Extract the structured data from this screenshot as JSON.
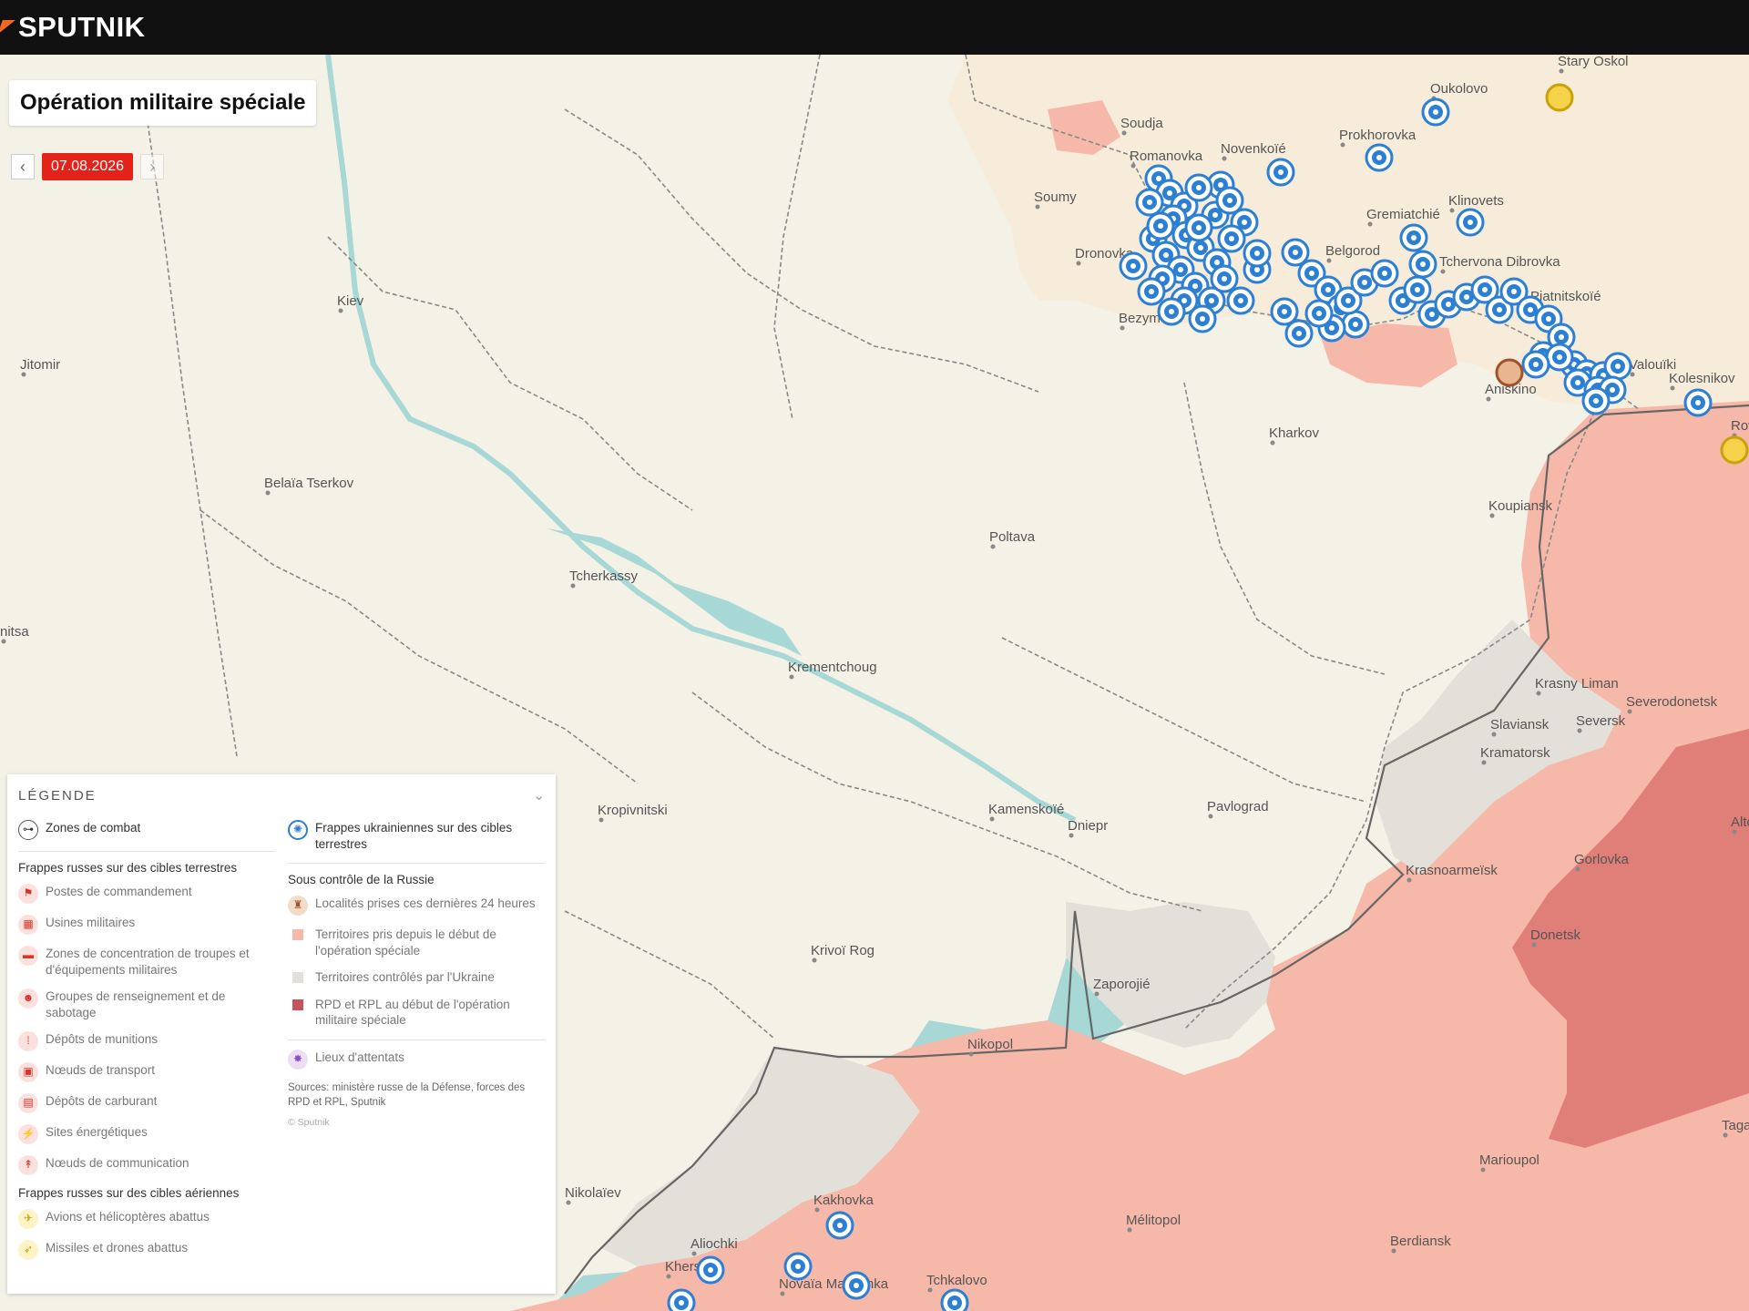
{
  "header": {
    "logo": "SPUTNIK"
  },
  "map": {
    "title": "Opération militaire spéciale",
    "date": "07.08.2026",
    "colors": {
      "land": "#f4f1e7",
      "russian_taken": "#f6b8a8",
      "rpd_rpl": "#e07e78",
      "ukraine_controlled": "#e3e0da",
      "water": "#a8d8d6",
      "strike": "#2d7fd3"
    },
    "cities": [
      {
        "name": "Soudja"
      },
      {
        "name": "Soumy"
      },
      {
        "name": "Romanovka"
      },
      {
        "name": "Novenkoïé"
      },
      {
        "name": "Prokhorovka"
      },
      {
        "name": "Oukolovo"
      },
      {
        "name": "Stary Oskol"
      },
      {
        "name": "Gremiatchié"
      },
      {
        "name": "Klinovets"
      },
      {
        "name": "Belgorod"
      },
      {
        "name": "Tchervona Dibrovka"
      },
      {
        "name": "Dronovka"
      },
      {
        "name": "Bezymeno"
      },
      {
        "name": "Piatnitskoïé"
      },
      {
        "name": "Valouïki"
      },
      {
        "name": "Kolesnikov"
      },
      {
        "name": "Aniskino"
      },
      {
        "name": "Rover"
      },
      {
        "name": "Kharkov"
      },
      {
        "name": "Koupiansk"
      },
      {
        "name": "Kiev"
      },
      {
        "name": "Jitomir"
      },
      {
        "name": "Belaïa Tserkov"
      },
      {
        "name": "nitsa"
      },
      {
        "name": "Poltava"
      },
      {
        "name": "Tcherkassy"
      },
      {
        "name": "Krementchoug"
      },
      {
        "name": "Krasny Liman"
      },
      {
        "name": "Severodonetsk"
      },
      {
        "name": "Slaviansk"
      },
      {
        "name": "Seversk"
      },
      {
        "name": "Kramatorsk"
      },
      {
        "name": "Kropivnitski"
      },
      {
        "name": "Kamenskoïé"
      },
      {
        "name": "Dniepr"
      },
      {
        "name": "Pavlograd"
      },
      {
        "name": "Altchevsk"
      },
      {
        "name": "Krasnoarmeïsk"
      },
      {
        "name": "Gorlovka"
      },
      {
        "name": "Donetsk"
      },
      {
        "name": "Krivoï Rog"
      },
      {
        "name": "Zaporojié"
      },
      {
        "name": "Nikopol"
      },
      {
        "name": "Taganrog"
      },
      {
        "name": "Marioupol"
      },
      {
        "name": "Nikolaïev"
      },
      {
        "name": "Kakhovka"
      },
      {
        "name": "Aliochki"
      },
      {
        "name": "Kherson"
      },
      {
        "name": "Mélitopol"
      },
      {
        "name": "Berdiansk"
      },
      {
        "name": "Novaïa Maiatchka"
      },
      {
        "name": "Tchkalovo"
      }
    ]
  },
  "legend": {
    "title": "LÉGENDE",
    "combat": "Zones de combat",
    "ground_header": "Frappes russes sur des cibles terrestres",
    "ground_items": [
      "Postes de commandement",
      "Usines militaires",
      "Zones de concentration de troupes et d'équipements militaires",
      "Groupes de renseignement et de sabotage",
      "Dépôts de munitions",
      "Nœuds de transport",
      "Dépôts de carburant",
      "Sites énergétiques",
      "Nœuds de communication"
    ],
    "air_header": "Frappes russes sur des cibles aériennes",
    "air_items": [
      "Avions et hélicoptères abattus",
      "Missiles et drones abattus"
    ],
    "ukr_strikes": "Frappes ukrainiennes sur des cibles terrestres",
    "control_header": "Sous contrôle de la Russie",
    "control_items": [
      "Localités prises ces dernières 24 heures",
      "Territoires pris depuis le début de l'opération spéciale",
      "Territoires contrôlés par l'Ukraine",
      "RPD et RPL au début de l'opération militaire spéciale"
    ],
    "attacks": "Lieux d'attentats",
    "sources": "Sources: ministère russe de la Défense, forces des RPD et RPL, Sputnik",
    "copyright": "© Sputnik"
  }
}
